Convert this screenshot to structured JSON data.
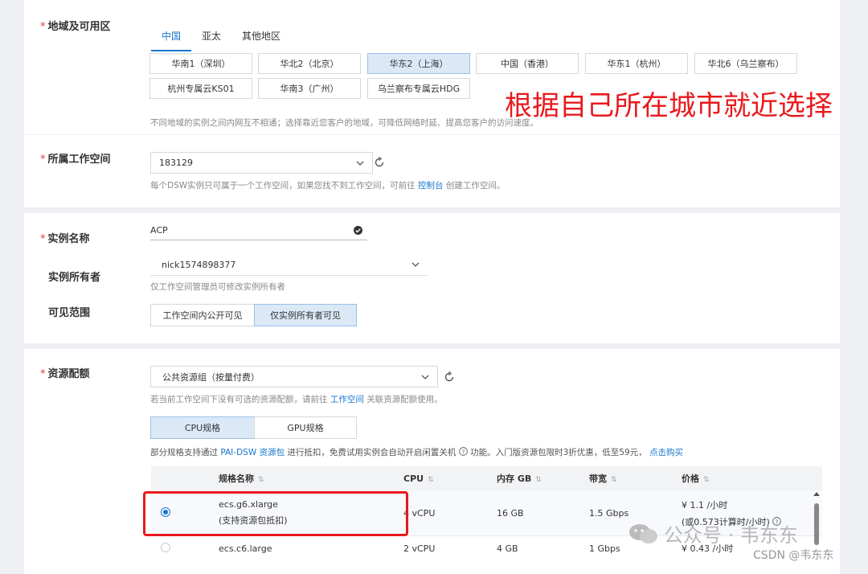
{
  "region": {
    "label": "地域及可用区",
    "tabs": [
      "中国",
      "亚太",
      "其他地区"
    ],
    "buttons": [
      "华南1（深圳）",
      "华北2（北京）",
      "华东2（上海）",
      "中国（香港）",
      "华东1（杭州）",
      "华北6（乌兰察布）",
      "杭州专属云KS01",
      "华南3（广州）",
      "乌兰察布专属云HDG"
    ],
    "selected": "华东2（上海）",
    "hint": "不同地域的实例之间内网互不相通；选择靠近您客户的地域，可降低网络时延、提高您客户的访问速度。",
    "annotation": "根据自己所在城市就近选择"
  },
  "workspace": {
    "label": "所属工作空间",
    "value": "183129",
    "hint_prefix": "每个DSW实例只可属于一个工作空间，如果您找不到工作空间，可前往",
    "hint_link": "控制台",
    "hint_suffix": "创建工作空间。"
  },
  "instance": {
    "name_label": "实例名称",
    "name_value": "ACP",
    "owner_label": "实例所有者",
    "owner_value": "nick1574898377",
    "owner_hint": "仅工作空间管理员可修改实例所有者",
    "visibility_label": "可见范围",
    "visibility_options": [
      "工作空间内公开可见",
      "仅实例所有者可见"
    ],
    "visibility_selected": "仅实例所有者可见"
  },
  "resource": {
    "label": "资源配额",
    "group_value": "公共资源组（按量付费）",
    "group_hint_prefix": "若当前工作空间下没有可选的资源配额，请前往",
    "group_hint_link": "工作空间",
    "group_hint_suffix": "关联资源配额使用。",
    "spec_tabs": [
      "CPU规格",
      "GPU规格"
    ],
    "spec_tab_selected": "CPU规格",
    "promo_prefix": "部分规格支持通过",
    "promo_link": "PAI-DSW 资源包",
    "promo_middle": "进行抵扣，免费试用实例会自动开启闲置关机",
    "promo_suffix": "功能。入门版资源包限时3折优惠，低至59元，",
    "promo_buy": "点击购买",
    "columns": [
      "规格名称",
      "CPU",
      "内存 GB",
      "带宽",
      "价格"
    ],
    "rows": [
      {
        "name": "ecs.g6.xlarge",
        "note": "(支持资源包抵扣)",
        "cpu": "4 vCPU",
        "mem": "16 GB",
        "bw": "1.5 Gbps",
        "price": "¥ 1.1 /小时",
        "price_note": "(或0.573计算时/小时)",
        "selected": true
      },
      {
        "name": "ecs.c6.large",
        "note": "",
        "cpu": "2 vCPU",
        "mem": "4 GB",
        "bw": "1 Gbps",
        "price": "¥ 0.43 /小时",
        "price_note": "",
        "selected": false
      }
    ]
  },
  "watermarks": {
    "wechat": "公众号 · 韦东东",
    "csdn": "CSDN @韦东东"
  },
  "colors": {
    "accent": "#1677cc",
    "required": "#e0403c",
    "annotation": "#e8191d",
    "selected_bg": "#dbe9f7"
  }
}
